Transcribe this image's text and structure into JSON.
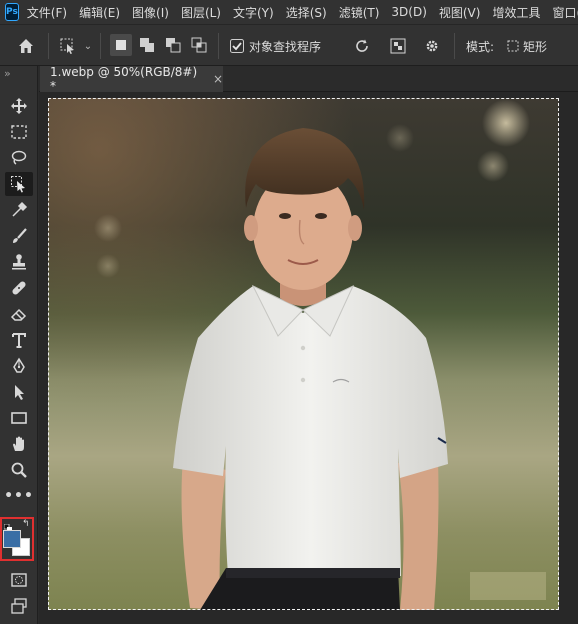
{
  "app": {
    "logo_text": "Ps"
  },
  "menu": [
    "文件(F)",
    "编辑(E)",
    "图像(I)",
    "图层(L)",
    "文字(Y)",
    "选择(S)",
    "滤镜(T)",
    "3D(D)",
    "视图(V)",
    "增效工具",
    "窗口(W)"
  ],
  "options": {
    "checkbox_label": "对象查找程序",
    "checkbox_checked": true,
    "mode_label": "模式:",
    "mode_value": "矩形"
  },
  "toolbar": {
    "collapse_label": "»",
    "tools": [
      "move-tool",
      "marquee-tool",
      "lasso-tool",
      "object-selection-tool",
      "eyedropper-tool",
      "brush-tool",
      "stamp-tool",
      "healing-tool",
      "eraser-tool",
      "type-tool",
      "pen-tool",
      "path-selection-tool",
      "rectangle-tool",
      "hand-tool",
      "zoom-tool",
      "more-tools"
    ],
    "selected_tool": "object-selection-tool",
    "foreground_color": "#3a6ea5",
    "background_color": "#ffffff",
    "highlight_color": "#e03030"
  },
  "document": {
    "tab_title": "1.webp @ 50%(RGB/8#) *",
    "tab_close": "×"
  },
  "colors": {
    "accent": "#31a8ff",
    "chrome": "#323232",
    "pasteboard": "#282828"
  }
}
